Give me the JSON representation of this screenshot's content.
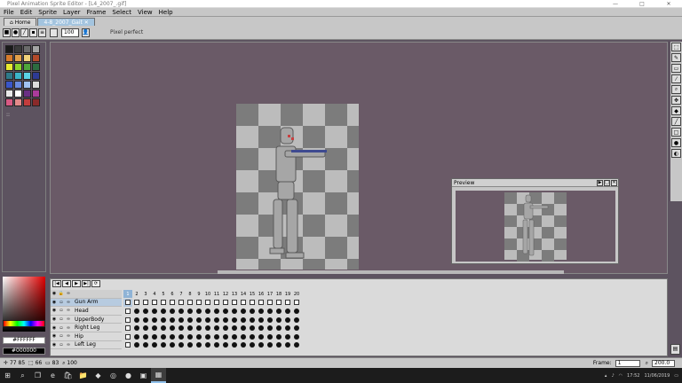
{
  "window": {
    "title": "Pixel Animation Sprite Editor - [L4_2007_.gif]",
    "min": "—",
    "max": "□",
    "close": "✕"
  },
  "menu": [
    "File",
    "Edit",
    "Sprite",
    "Layer",
    "Frame",
    "Select",
    "View",
    "Help"
  ],
  "tabs": [
    {
      "label": "Home"
    },
    {
      "label": "4-8_2007_Gait"
    }
  ],
  "toolbar": {
    "zoom": "100",
    "status": "Pixel perfect"
  },
  "palette": {
    "colors": [
      "#1a1a1a",
      "#3b3b3b",
      "#6b6b6b",
      "#a4a4a4",
      "#d67b2c",
      "#e2a04a",
      "#f0d27a",
      "#b24a2a",
      "#e8e830",
      "#8cd22d",
      "#4ea63b",
      "#2c6c40",
      "#2f7a8a",
      "#3bb5c8",
      "#5ad2e6",
      "#2d3a94",
      "#3a56c8",
      "#6a8ae0",
      "#a0c2f2",
      "#dcdcdc",
      "#e8e8e8",
      "#ffffff",
      "#6a2f84",
      "#aa3b9b",
      "#d85a84",
      "#e38a8a",
      "#c33c3c",
      "#8a2a2a"
    ]
  },
  "colorbox": {
    "fg": "#FFFFFF",
    "bg": "#000000"
  },
  "preview": {
    "title": "Preview"
  },
  "timeline": {
    "controls": [
      "|◀",
      "◀",
      "▶",
      "▶|",
      "⟳"
    ],
    "layers": [
      {
        "name": "Gun Arm"
      },
      {
        "name": "Head"
      },
      {
        "name": "UpperBody"
      },
      {
        "name": "Right Leg"
      },
      {
        "name": "Hip"
      },
      {
        "name": "Left Leg"
      }
    ],
    "frames": [
      "1",
      "2",
      "3",
      "4",
      "5",
      "6",
      "7",
      "8",
      "9",
      "10",
      "11",
      "12",
      "13",
      "14",
      "15",
      "16",
      "17",
      "18",
      "19",
      "20"
    ]
  },
  "status": {
    "coords": "77 85",
    "sel": "66",
    "size": "83",
    "zoom": "100",
    "frame_label": "Frame:",
    "frame_value": "1",
    "zoom_value": "200.0"
  },
  "taskbar": {
    "time": "17:52",
    "date": "11/06/2019"
  }
}
